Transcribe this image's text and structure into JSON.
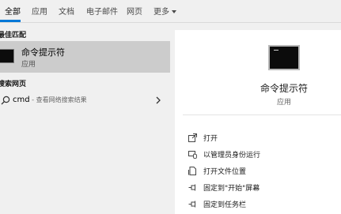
{
  "tabs": [
    {
      "label": "全部",
      "active": true
    },
    {
      "label": "应用"
    },
    {
      "label": "文档"
    },
    {
      "label": "电子邮件"
    },
    {
      "label": "网页"
    },
    {
      "label": "更多"
    }
  ],
  "left": {
    "best_match_header": "最佳匹配",
    "best_match": {
      "title": "命令提示符",
      "subtitle": "应用",
      "icon": "cmd-icon"
    },
    "web_header": "搜索网页",
    "web_result": {
      "query": "cmd",
      "description": " - 查看网络搜索结果",
      "icon": "search-icon"
    }
  },
  "right": {
    "title": "命令提示符",
    "subtitle": "应用",
    "actions": [
      {
        "label": "打开",
        "icon": "open-icon"
      },
      {
        "label": "以管理员身份运行",
        "icon": "admin-shield-icon"
      },
      {
        "label": "打开文件位置",
        "icon": "file-location-icon"
      },
      {
        "label": "固定到\"开始\"屏幕",
        "icon": "pin-icon"
      },
      {
        "label": "固定到任务栏",
        "icon": "pin-icon"
      }
    ]
  },
  "colors": {
    "accent": "#0078d7",
    "selected_background": "#cccccc",
    "panel_background": "#f0f0f0",
    "detail_background": "#ffffff"
  }
}
